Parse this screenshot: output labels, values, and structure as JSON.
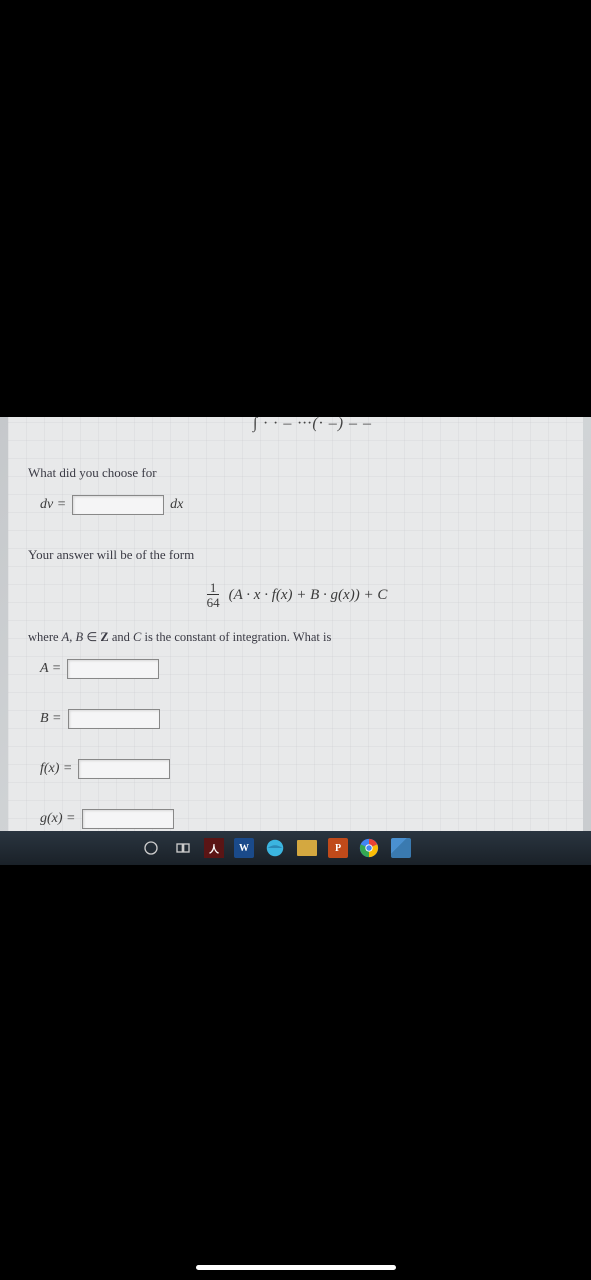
{
  "top_fragment": "∫ · · – ···(· –) – –",
  "question1": "What did you choose for",
  "dv_label": "dv =",
  "dx_label": "dx",
  "form_intro": "Your answer will be of the form",
  "formula": {
    "frac_num": "1",
    "frac_den": "64",
    "body": "(A · x · f(x) + B · g(x)) + C"
  },
  "where_text": "where A, B ∈ Z and C is the constant of integration. What is",
  "labels": {
    "A": "A =",
    "B": "B =",
    "fx": "f(x) =",
    "gx": "g(x) ="
  },
  "inputs": {
    "dv": "",
    "A": "",
    "B": "",
    "fx": "",
    "gx": ""
  }
}
